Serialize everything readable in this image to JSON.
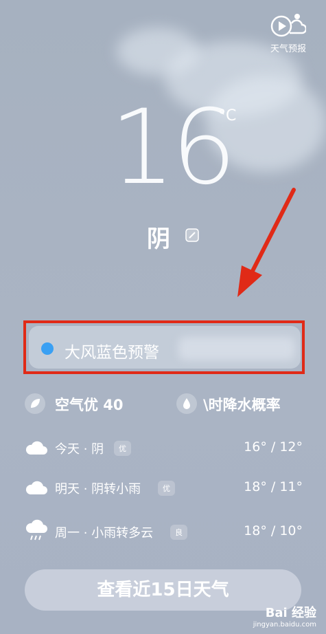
{
  "forecast_button": {
    "label": "天气预报",
    "icon": "play-cloud-icon"
  },
  "current": {
    "temperature": "16",
    "unit": "°C",
    "condition": "阴"
  },
  "alert": {
    "text": "大风蓝色预警"
  },
  "aqi": {
    "text": "空气优 40"
  },
  "rain": {
    "text": "\\时降水概率"
  },
  "days": [
    {
      "label": "今天 · 阴",
      "badge": "优",
      "range": "16° / 12°",
      "icon": "cloud-icon"
    },
    {
      "label": "明天 · 阴转小雨",
      "badge": "优",
      "range": "18° / 11°",
      "icon": "cloud-icon"
    },
    {
      "label": "周一 · 小雨转多云",
      "badge": "良",
      "range": "18° / 10°",
      "icon": "rain-cloud-icon"
    }
  ],
  "cta": {
    "label": "查看近15日天气"
  },
  "watermark": {
    "main": "Bai 经验",
    "sub": "jingyan.baidu.com"
  },
  "colors": {
    "highlight": "#e02a17",
    "alert_dot": "#3aa0f3"
  }
}
